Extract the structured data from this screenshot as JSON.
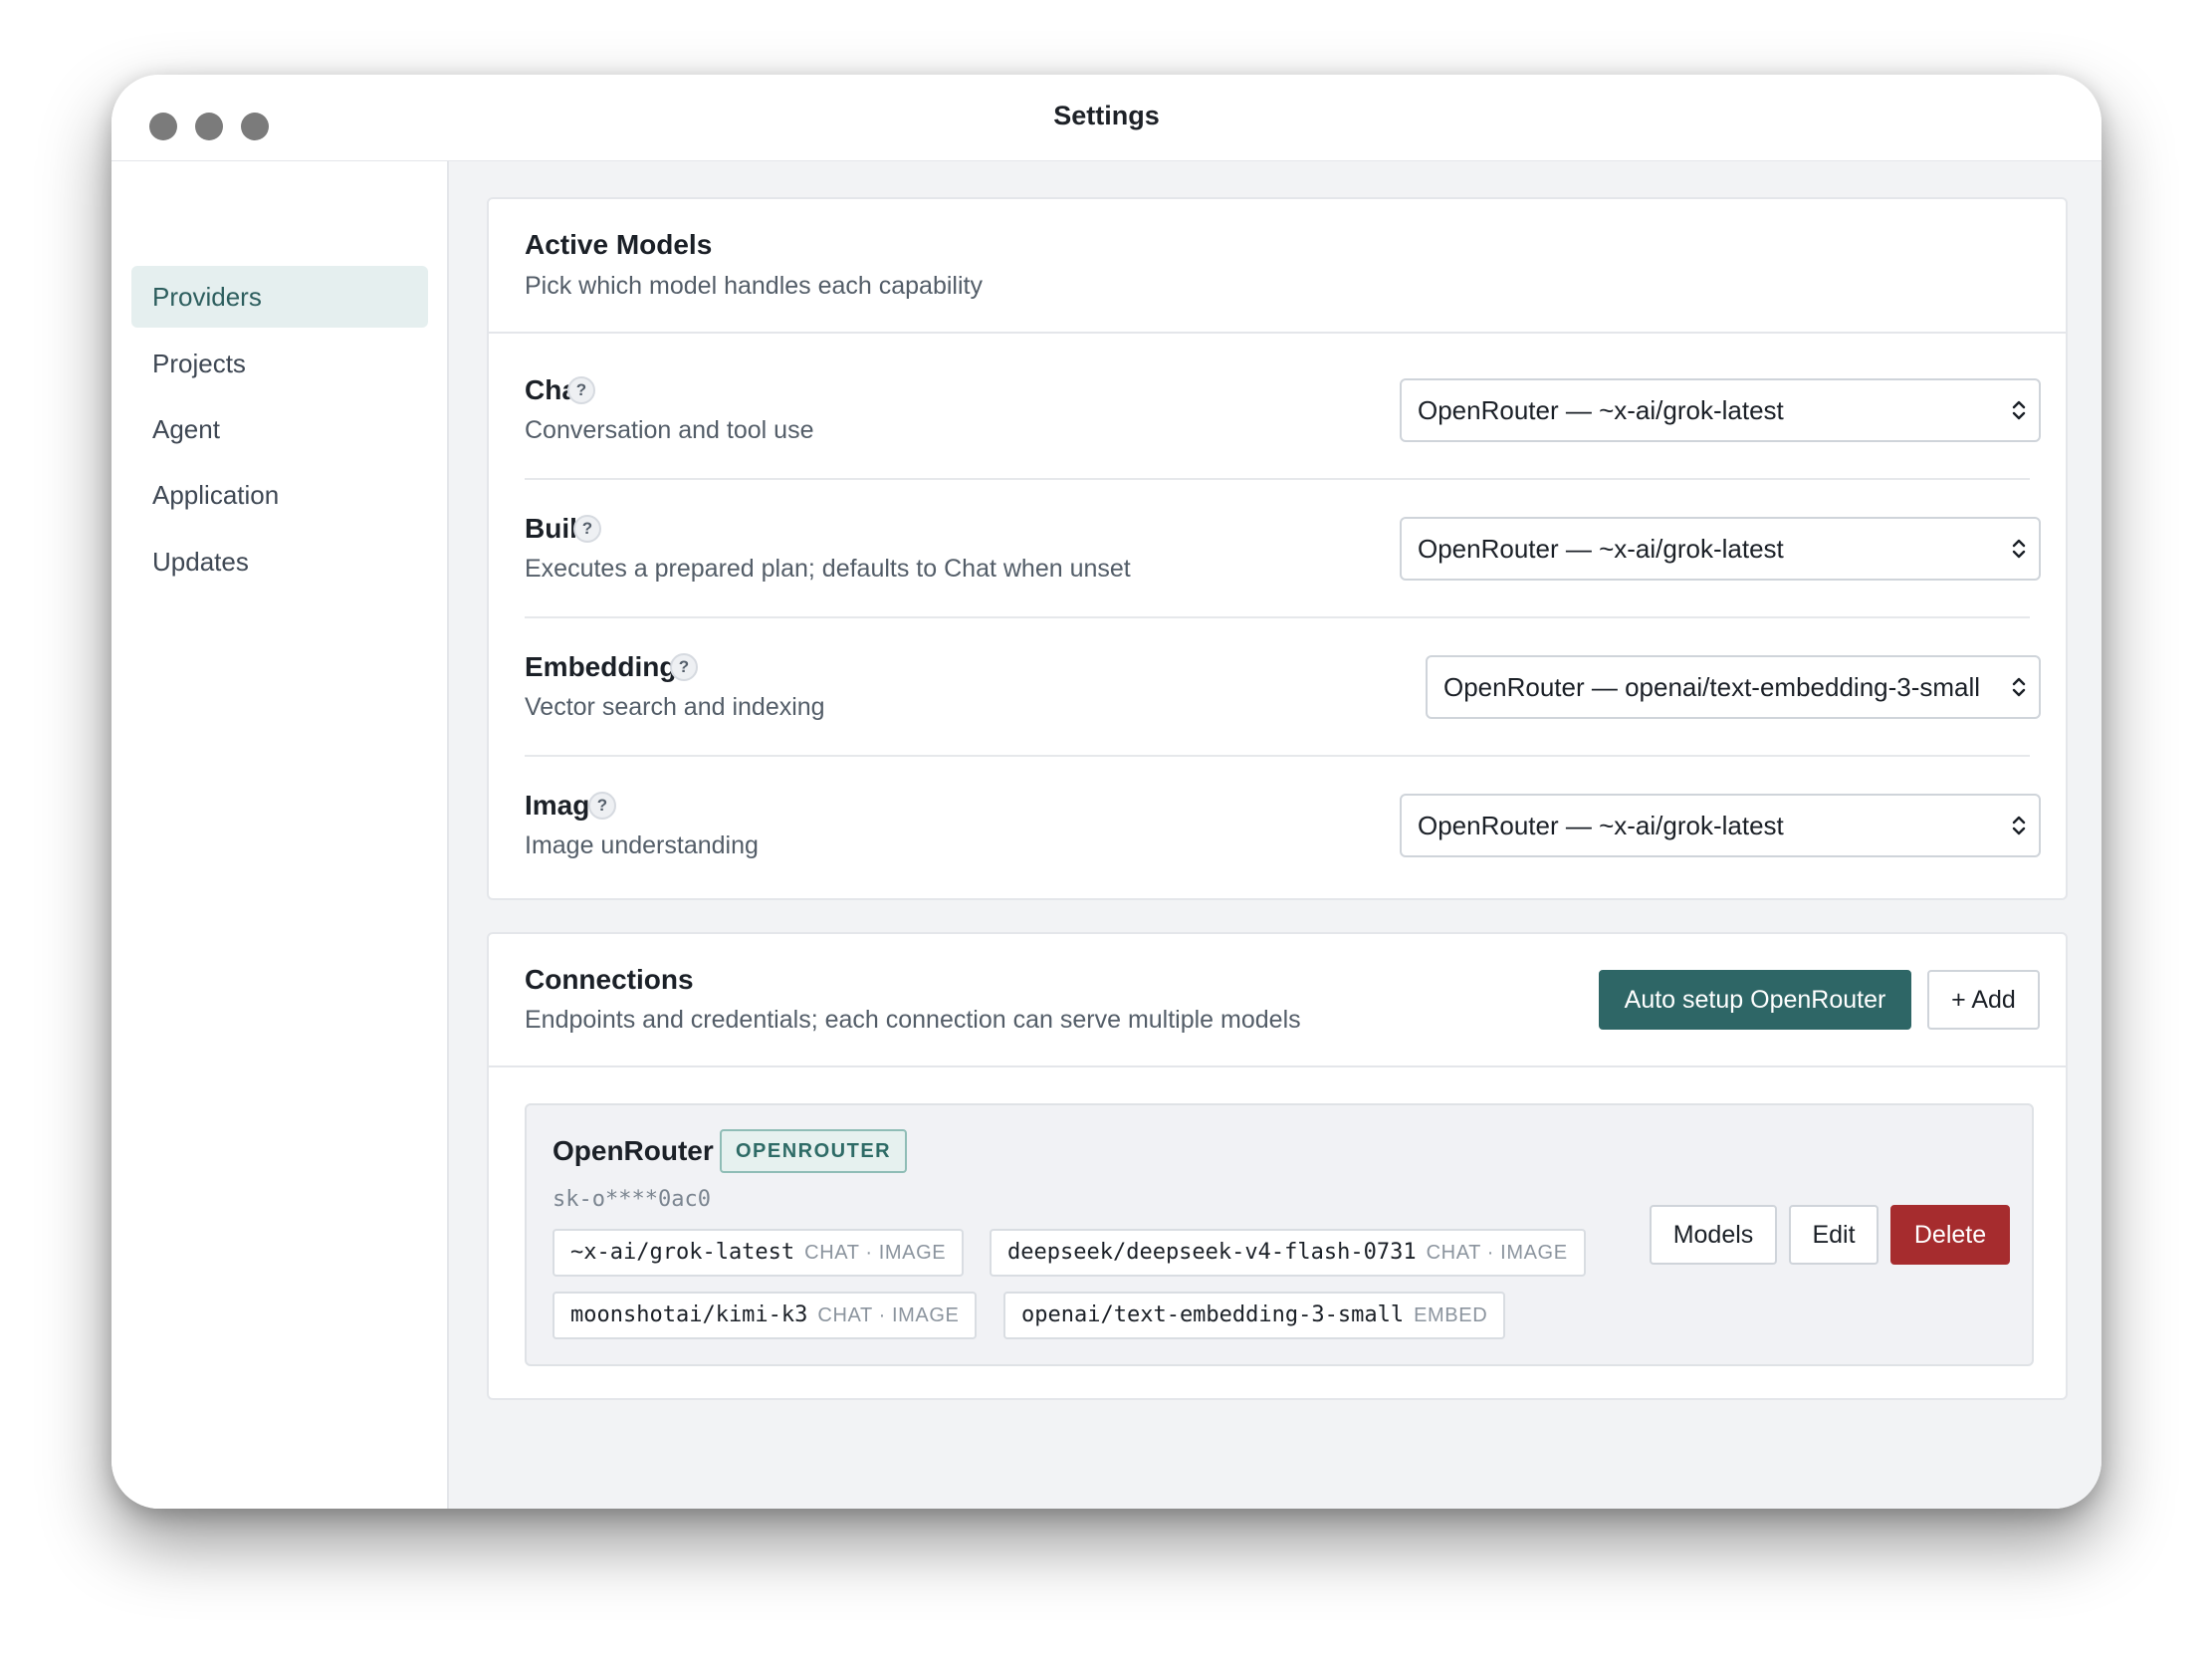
{
  "window": {
    "title": "Settings"
  },
  "sidebar": {
    "items": [
      {
        "label": "Providers",
        "active": true
      },
      {
        "label": "Projects",
        "active": false
      },
      {
        "label": "Agent",
        "active": false
      },
      {
        "label": "Application",
        "active": false
      },
      {
        "label": "Updates",
        "active": false
      }
    ]
  },
  "active_models": {
    "title": "Active Models",
    "subtitle": "Pick which model handles each capability",
    "rows": [
      {
        "label": "Chat",
        "help": "?",
        "description": "Conversation and tool use",
        "selected": "OpenRouter — ~x-ai/grok-latest"
      },
      {
        "label": "Build",
        "help": "?",
        "description": "Executes a prepared plan; defaults to Chat when unset",
        "selected": "OpenRouter — ~x-ai/grok-latest"
      },
      {
        "label": "Embeddings",
        "help": "?",
        "description": "Vector search and indexing",
        "selected": "OpenRouter — openai/text-embedding-3-small"
      },
      {
        "label": "Image",
        "help": "?",
        "description": "Image understanding",
        "selected": "OpenRouter — ~x-ai/grok-latest"
      }
    ]
  },
  "connections": {
    "title": "Connections",
    "subtitle": "Endpoints and credentials; each connection can serve multiple models",
    "auto_setup_label": "Auto setup OpenRouter",
    "add_label": "+ Add",
    "items": [
      {
        "name": "OpenRouter",
        "badge": "OPENROUTER",
        "key": "sk-o****0ac0",
        "models": [
          {
            "id": "~x-ai/grok-latest",
            "caps": "CHAT · IMAGE"
          },
          {
            "id": "deepseek/deepseek-v4-flash-0731",
            "caps": "CHAT · IMAGE"
          },
          {
            "id": "moonshotai/kimi-k3",
            "caps": "CHAT · IMAGE"
          },
          {
            "id": "openai/text-embedding-3-small",
            "caps": "EMBED"
          }
        ],
        "actions": {
          "models_label": "Models",
          "edit_label": "Edit",
          "delete_label": "Delete"
        }
      }
    ]
  },
  "colors": {
    "accent": "#2e6666",
    "danger": "#a62c2e",
    "sidebar_active_bg": "#e5efef",
    "badge_bg": "#e6f1ef",
    "content_bg": "#f2f3f5"
  },
  "icons": {
    "window_controls": [
      "window-close-icon",
      "window-minimize-icon",
      "window-zoom-icon"
    ],
    "select_chevron": "chevron-updown-icon",
    "help": "help-icon"
  }
}
